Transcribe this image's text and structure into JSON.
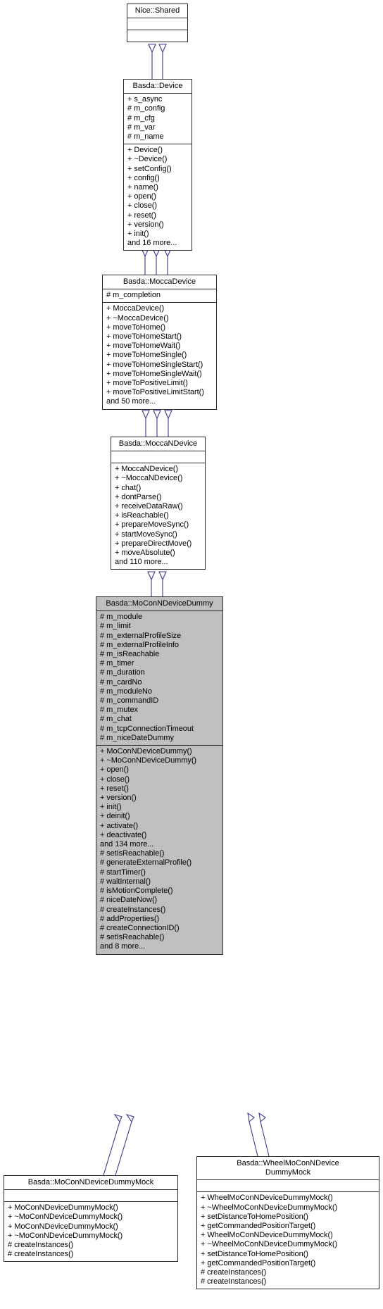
{
  "diagram": {
    "kind": "uml-class-inheritance-diagram",
    "background_color": "#ffffff",
    "edge_color": "#3b3b8f",
    "highlight_color": "#bfbfbf",
    "border_color": "#2b2b2b"
  },
  "classes": [
    {
      "id": "nice_shared",
      "title": "Nice::Shared",
      "attributes": [],
      "methods": [],
      "highlighted": false
    },
    {
      "id": "basda_device",
      "title": "Basda::Device",
      "attributes": [
        "+ s_async",
        "# m_config",
        "# m_cfg",
        "# m_var",
        "# m_name"
      ],
      "methods": [
        "+ Device()",
        "+ ~Device()",
        "+ setConfig()",
        "+ config()",
        "+ name()",
        "+ open()",
        "+ close()",
        "+ reset()",
        "+ version()",
        "+ init()",
        "and 16 more..."
      ],
      "highlighted": false
    },
    {
      "id": "basda_moccadevice",
      "title": "Basda::MoccaDevice",
      "attributes": [
        "# m_completion"
      ],
      "methods": [
        "+ MoccaDevice()",
        "+ ~MoccaDevice()",
        "+ moveToHome()",
        "+ moveToHomeStart()",
        "+ moveToHomeWait()",
        "+ moveToHomeSingle()",
        "+ moveToHomeSingleStart()",
        "+ moveToHomeSingleWait()",
        "+ moveToPositiveLimit()",
        "+ moveToPositiveLimitStart()",
        "and 50 more..."
      ],
      "highlighted": false
    },
    {
      "id": "basda_moccandevice",
      "title": "Basda::MoccaNDevice",
      "attributes": [],
      "methods": [
        "+ MoccaNDevice()",
        "+ ~MoccaNDevice()",
        "+ chat()",
        "+ dontParse()",
        "+ receiveDataRaw()",
        "+ isReachable()",
        "+ prepareMoveSync()",
        "+ startMoveSync()",
        "+ prepareDirectMove()",
        "+ moveAbsolute()",
        "and 110 more..."
      ],
      "highlighted": false
    },
    {
      "id": "basda_moconndevicedummy",
      "title": "Basda::MoConNDeviceDummy",
      "attributes": [
        "# m_module",
        "# m_limit",
        "# m_externalProfileSize",
        "# m_externalProfileInfo",
        "# m_isReachable",
        "# m_timer",
        "# m_duration",
        "# m_cardNo",
        "# m_moduleNo",
        "# m_commandID",
        "# m_mutex",
        "# m_chat",
        "# m_tcpConnectionTimeout",
        "# m_niceDateDummy"
      ],
      "methods": [
        "+ MoConNDeviceDummy()",
        "+ ~MoConNDeviceDummy()",
        "+ open()",
        "+ close()",
        "+ reset()",
        "+ version()",
        "+ init()",
        "+ deinit()",
        "+ activate()",
        "+ deactivate()",
        "and 134 more...",
        "# setIsReachable()",
        "# generateExternalProfile()",
        "# startTimer()",
        "# waitInternal()",
        "# isMotionComplete()",
        "# niceDateNow()",
        "# createInstances()",
        "# addProperties()",
        "# createConnectionID()",
        "# setIsReachable()",
        "and 8 more..."
      ],
      "highlighted": true
    },
    {
      "id": "basda_moconndevicedummymock",
      "title": "Basda::MoConNDeviceDummyMock",
      "attributes": [],
      "methods": [
        "+ MoConNDeviceDummyMock()",
        "+ ~MoConNDeviceDummyMock()",
        "+ MoConNDeviceDummyMock()",
        "+ ~MoConNDeviceDummyMock()",
        "# createInstances()",
        "# createInstances()"
      ],
      "highlighted": false
    },
    {
      "id": "basda_wheelmoconndevicedummymock",
      "title": "Basda::WheelMoConNDevice\nDummyMock",
      "attributes": [],
      "methods": [
        "+ WheelMoConNDeviceDummyMock()",
        "+ ~WheelMoConNDeviceDummyMock()",
        "+ setDistanceToHomePosition()",
        "+ getCommandedPositionTarget()",
        "+ WheelMoConNDeviceDummyMock()",
        "+ ~WheelMoConNDeviceDummyMock()",
        "+ setDistanceToHomePosition()",
        "+ getCommandedPositionTarget()",
        "# createInstances()",
        "# createInstances()"
      ],
      "highlighted": false
    }
  ]
}
